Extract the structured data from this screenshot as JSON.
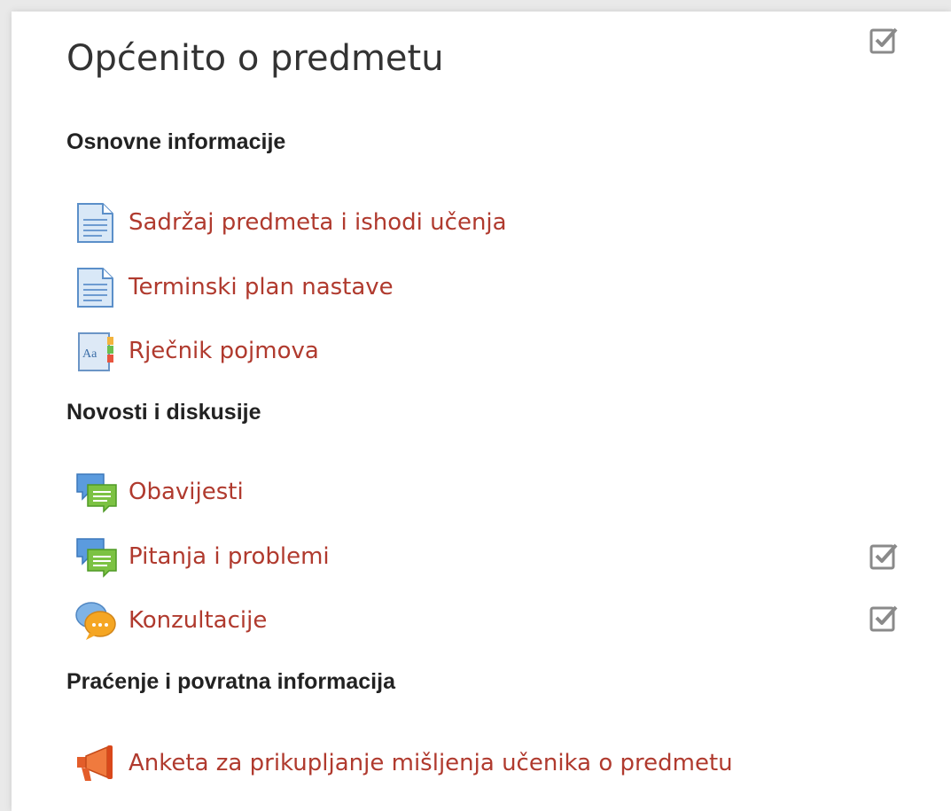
{
  "section": {
    "title": "Općenito o predmetu"
  },
  "groups": [
    {
      "heading": "Osnovne informacije",
      "items": [
        {
          "label": "Sadržaj predmeta i ishodi učenja",
          "icon": "page-icon",
          "completion": false
        },
        {
          "label": "Terminski plan nastave",
          "icon": "page-icon",
          "completion": false
        },
        {
          "label": "Rječnik pojmova",
          "icon": "glossary-icon",
          "completion": false
        }
      ]
    },
    {
      "heading": "Novosti i diskusije",
      "items": [
        {
          "label": "Obavijesti",
          "icon": "forum-icon",
          "completion": false
        },
        {
          "label": "Pitanja i problemi",
          "icon": "forum-icon",
          "completion": true
        },
        {
          "label": "Konzultacije",
          "icon": "chat-icon",
          "completion": true
        }
      ]
    },
    {
      "heading": "Praćenje i povratna informacija",
      "items": [
        {
          "label": "Anketa za prikupljanje mišljenja učenika o predmetu",
          "icon": "feedback-megaphone-icon",
          "completion": false
        }
      ]
    }
  ],
  "colors": {
    "link": "#b03a2e",
    "heading": "#222222",
    "checkbox": "#8a8a8a"
  }
}
